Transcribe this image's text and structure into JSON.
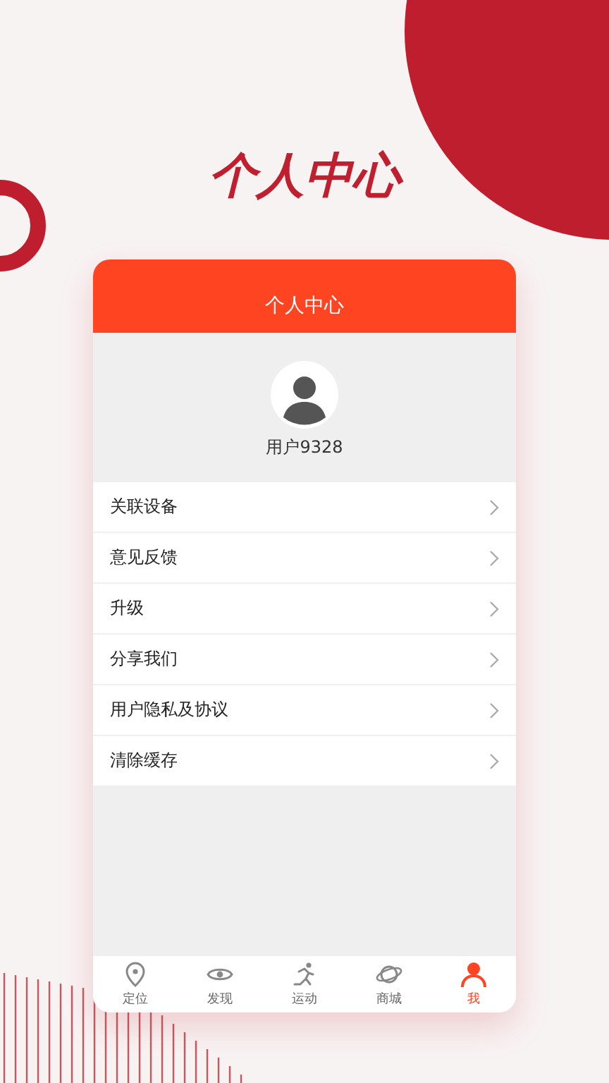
{
  "headline": "个人中心",
  "card": {
    "title": "个人中心",
    "profile": {
      "username": "用户9328"
    },
    "menu": [
      {
        "label": "关联设备"
      },
      {
        "label": "意见反馈"
      },
      {
        "label": "升级"
      },
      {
        "label": "分享我们"
      },
      {
        "label": "用户隐私及协议"
      },
      {
        "label": "清除缓存"
      }
    ],
    "tab_bar": [
      {
        "kind": "pin",
        "label": "定位",
        "selected": false
      },
      {
        "kind": "eye",
        "label": "发现",
        "selected": false
      },
      {
        "kind": "runner",
        "label": "运动",
        "selected": false
      },
      {
        "kind": "planet",
        "label": "商城",
        "selected": false
      },
      {
        "kind": "person",
        "label": "我",
        "selected": true
      }
    ]
  }
}
